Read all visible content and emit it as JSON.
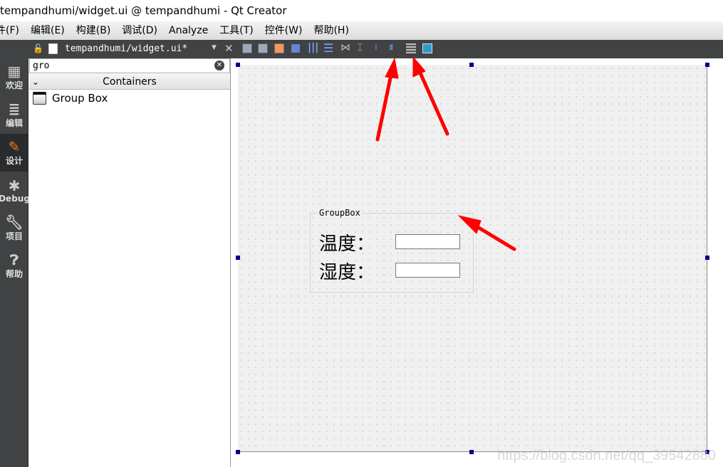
{
  "window": {
    "title": "tempandhumi/widget.ui @ tempandhumi - Qt Creator"
  },
  "menu": [
    "件(F)",
    "编辑(E)",
    "构建(B)",
    "调试(D)",
    "Analyze",
    "工具(T)",
    "控件(W)",
    "帮助(H)"
  ],
  "editor_tab": {
    "file": "tempandhumi/widget.ui*"
  },
  "modes": [
    {
      "label": "欢迎",
      "icon": "grid-icon"
    },
    {
      "label": "编辑",
      "icon": "edit-icon"
    },
    {
      "label": "设计",
      "icon": "pencil-icon",
      "active": true
    },
    {
      "label": "Debug",
      "icon": "bug-icon"
    },
    {
      "label": "项目",
      "icon": "wrench-icon"
    },
    {
      "label": "帮助",
      "icon": "help-icon"
    }
  ],
  "widget_box": {
    "search_value": "gro",
    "category": "Containers",
    "items": [
      "Group Box"
    ]
  },
  "form": {
    "groupbox_title": "GroupBox",
    "labels": [
      "温度：",
      "湿度："
    ]
  },
  "annotation_color": "#ff0000",
  "watermark": "https://blog.csdn.net/qq_39542880"
}
